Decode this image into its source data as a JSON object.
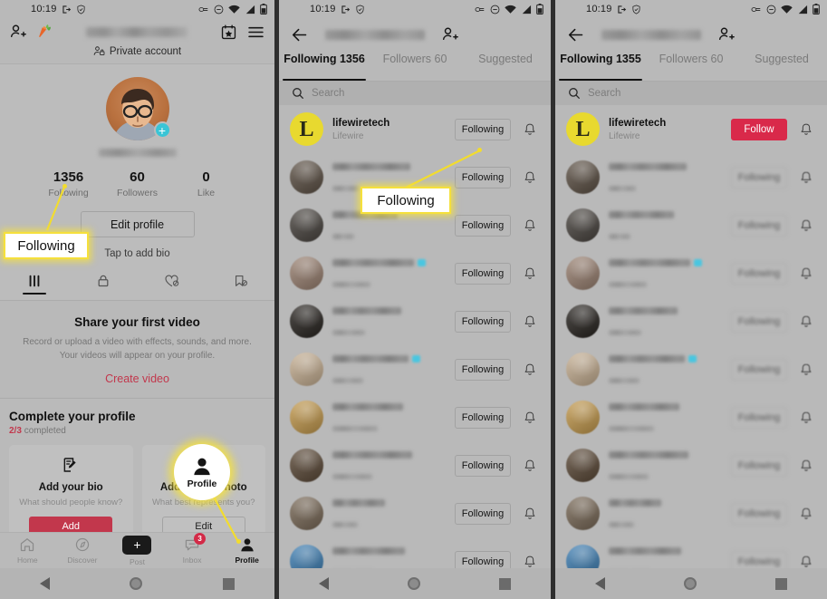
{
  "statusbar": {
    "time": "10:19",
    "icons": [
      "exit-icon",
      "shield-icon",
      "link-icon",
      "dnd-icon",
      "wifi-icon",
      "signal-icon",
      "battery-icon"
    ]
  },
  "panel1": {
    "header": {
      "add_person_icon": "add-person-icon",
      "carrot_icon": "carrot-icon",
      "username_blurred": "",
      "calendar_icon": "calendar-star-icon",
      "menu_icon": "hamburger-menu-icon"
    },
    "private_account_label": "Private account",
    "avatar_plus": "+",
    "stats": [
      {
        "num": "1356",
        "label": "Following"
      },
      {
        "num": "60",
        "label": "Followers"
      },
      {
        "num": "0",
        "label": "Like"
      }
    ],
    "edit_profile_label": "Edit profile",
    "bio_hint": "Tap to add bio",
    "content_tabs": [
      "grid-icon",
      "lock-icon",
      "heart-hidden-icon",
      "bookmark-hidden-icon"
    ],
    "empty_state": {
      "title": "Share your first video",
      "line1": "Record or upload a video with effects, sounds, and more.",
      "line2": "Your videos will appear on your profile.",
      "cta": "Create video"
    },
    "complete_profile": {
      "title": "Complete your profile",
      "progress": "2/3",
      "progress_suffix": "completed",
      "cards": [
        {
          "icon": "edit-note-icon",
          "title": "Add your bio",
          "sub": "What should people know?",
          "button": "Add"
        },
        {
          "icon": "camera-icon",
          "title": "Add profile photo",
          "sub": "What best represents you?",
          "button": "Edit"
        }
      ]
    },
    "bottom_nav": [
      {
        "icon": "home-icon",
        "label": "Home",
        "badge": ""
      },
      {
        "icon": "compass-icon",
        "label": "Discover",
        "badge": ""
      },
      {
        "icon": "plus-icon",
        "label": "Post",
        "badge": ""
      },
      {
        "icon": "inbox-icon",
        "label": "Inbox",
        "badge": "3"
      },
      {
        "icon": "profile-icon",
        "label": "Profile",
        "badge": ""
      }
    ],
    "callout_following": "Following",
    "callout_profile": "Profile"
  },
  "panel2": {
    "back_icon": "back-arrow-icon",
    "title_blurred": "",
    "add_person_icon": "add-person-icon",
    "tabs": [
      {
        "label": "Following 1356",
        "active": true
      },
      {
        "label": "Followers 60",
        "active": false
      },
      {
        "label": "Suggested",
        "active": false
      }
    ],
    "search_placeholder": "Search",
    "search_icon": "search-icon",
    "callout_following": "Following",
    "rows": [
      {
        "name": "lifewiretech",
        "sub": "Lifewire",
        "blurred": false,
        "avatar": "lifewire-logo",
        "button": "Following",
        "button_style": "outline",
        "bell": "bell-icon"
      },
      {
        "name": "",
        "sub": "",
        "blurred": true,
        "avatar": "#5e5246",
        "button": "Following",
        "button_style": "outline",
        "bell": "bell-icon"
      },
      {
        "name": "",
        "sub": "",
        "blurred": true,
        "avatar": "#4a4540",
        "button": "Following",
        "button_style": "outline",
        "bell": "bell-icon"
      },
      {
        "name": "",
        "sub": "",
        "blurred": true,
        "avatar": "#9b8272",
        "button": "Following",
        "button_style": "outline",
        "bell": "bell-icon"
      },
      {
        "name": "",
        "sub": "",
        "blurred": true,
        "avatar": "#282420",
        "button": "Following",
        "button_style": "outline",
        "bell": "bell-icon"
      },
      {
        "name": "",
        "sub": "",
        "blurred": true,
        "avatar": "#c8b194",
        "button": "Following",
        "button_style": "outline",
        "bell": "bell-icon"
      },
      {
        "name": "",
        "sub": "",
        "blurred": true,
        "avatar": "#c59b4e",
        "button": "Following",
        "button_style": "outline",
        "bell": "bell-icon"
      },
      {
        "name": "",
        "sub": "",
        "blurred": true,
        "avatar": "#5c4a38",
        "button": "Following",
        "button_style": "outline",
        "bell": "bell-icon"
      },
      {
        "name": "",
        "sub": "",
        "blurred": true,
        "avatar": "#7a6a58",
        "button": "Following",
        "button_style": "outline",
        "bell": "bell-icon"
      },
      {
        "name": "",
        "sub": "",
        "blurred": true,
        "avatar": "#3f80b5",
        "button": "Following",
        "button_style": "outline",
        "bell": "bell-icon"
      }
    ]
  },
  "panel3": {
    "back_icon": "back-arrow-icon",
    "title_blurred": "",
    "add_person_icon": "add-person-icon",
    "tabs": [
      {
        "label": "Following 1355",
        "active": true
      },
      {
        "label": "Followers 60",
        "active": false
      },
      {
        "label": "Suggested",
        "active": false
      }
    ],
    "search_placeholder": "Search",
    "search_icon": "search-icon",
    "rows": [
      {
        "name": "lifewiretech",
        "sub": "Lifewire",
        "blurred": false,
        "avatar": "lifewire-logo",
        "button": "Follow",
        "button_style": "primary",
        "bell": "bell-icon"
      },
      {
        "name": "",
        "sub": "",
        "blurred": true,
        "avatar": "#5e5246",
        "button": "Following",
        "button_style": "blurred",
        "bell": "bell-icon"
      },
      {
        "name": "",
        "sub": "",
        "blurred": true,
        "avatar": "#4a4540",
        "button": "Following",
        "button_style": "blurred",
        "bell": "bell-icon"
      },
      {
        "name": "",
        "sub": "",
        "blurred": true,
        "avatar": "#9b8272",
        "button": "Following",
        "button_style": "blurred",
        "bell": "bell-icon"
      },
      {
        "name": "",
        "sub": "",
        "blurred": true,
        "avatar": "#282420",
        "button": "Following",
        "button_style": "blurred",
        "bell": "bell-icon"
      },
      {
        "name": "",
        "sub": "",
        "blurred": true,
        "avatar": "#c8b194",
        "button": "Following",
        "button_style": "blurred",
        "bell": "bell-icon"
      },
      {
        "name": "",
        "sub": "",
        "blurred": true,
        "avatar": "#c59b4e",
        "button": "Following",
        "button_style": "blurred",
        "bell": "bell-icon"
      },
      {
        "name": "",
        "sub": "",
        "blurred": true,
        "avatar": "#5c4a38",
        "button": "Following",
        "button_style": "blurred",
        "bell": "bell-icon"
      },
      {
        "name": "",
        "sub": "",
        "blurred": true,
        "avatar": "#7a6a58",
        "button": "Following",
        "button_style": "blurred",
        "bell": "bell-icon"
      },
      {
        "name": "",
        "sub": "",
        "blurred": true,
        "avatar": "#3f80b5",
        "button": "Following",
        "button_style": "blurred",
        "bell": "bell-icon"
      }
    ]
  },
  "android_nav": [
    "back-triangle-icon",
    "home-circle-icon",
    "recents-square-icon"
  ],
  "colors": {
    "accent_red": "#c2374c",
    "follow_red": "#d9294a",
    "callout_yellow": "#f5e03c",
    "lifewire_yellow": "#e8d92f",
    "cyan": "#39c5d6"
  }
}
